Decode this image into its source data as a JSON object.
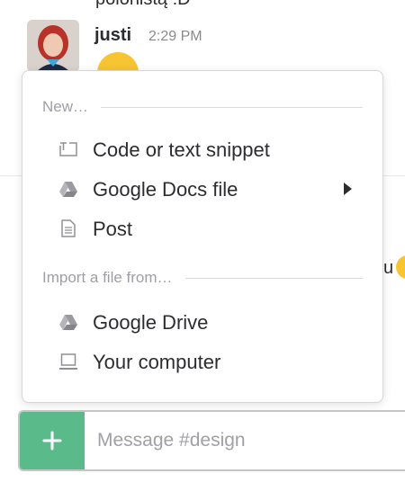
{
  "chat": {
    "previous_message_tail": "polonistą :D",
    "message": {
      "author": "justi",
      "time": "2:29 PM",
      "emoji": "smile-emoji"
    },
    "partial_text": "u"
  },
  "menu": {
    "new_section": {
      "header": "New…",
      "items": [
        {
          "label": "Code or text snippet",
          "icon": "snippet-icon",
          "has_submenu": false
        },
        {
          "label": "Google Docs file",
          "icon": "google-drive-icon",
          "has_submenu": true
        },
        {
          "label": "Post",
          "icon": "post-document-icon",
          "has_submenu": false
        }
      ]
    },
    "import_section": {
      "header": "Import a file from…",
      "items": [
        {
          "label": "Google Drive",
          "icon": "google-drive-icon"
        },
        {
          "label": "Your computer",
          "icon": "laptop-icon"
        }
      ]
    }
  },
  "composer": {
    "add_button_icon": "plus-icon",
    "placeholder": "Message #design",
    "accent_color": "#5aba89"
  }
}
